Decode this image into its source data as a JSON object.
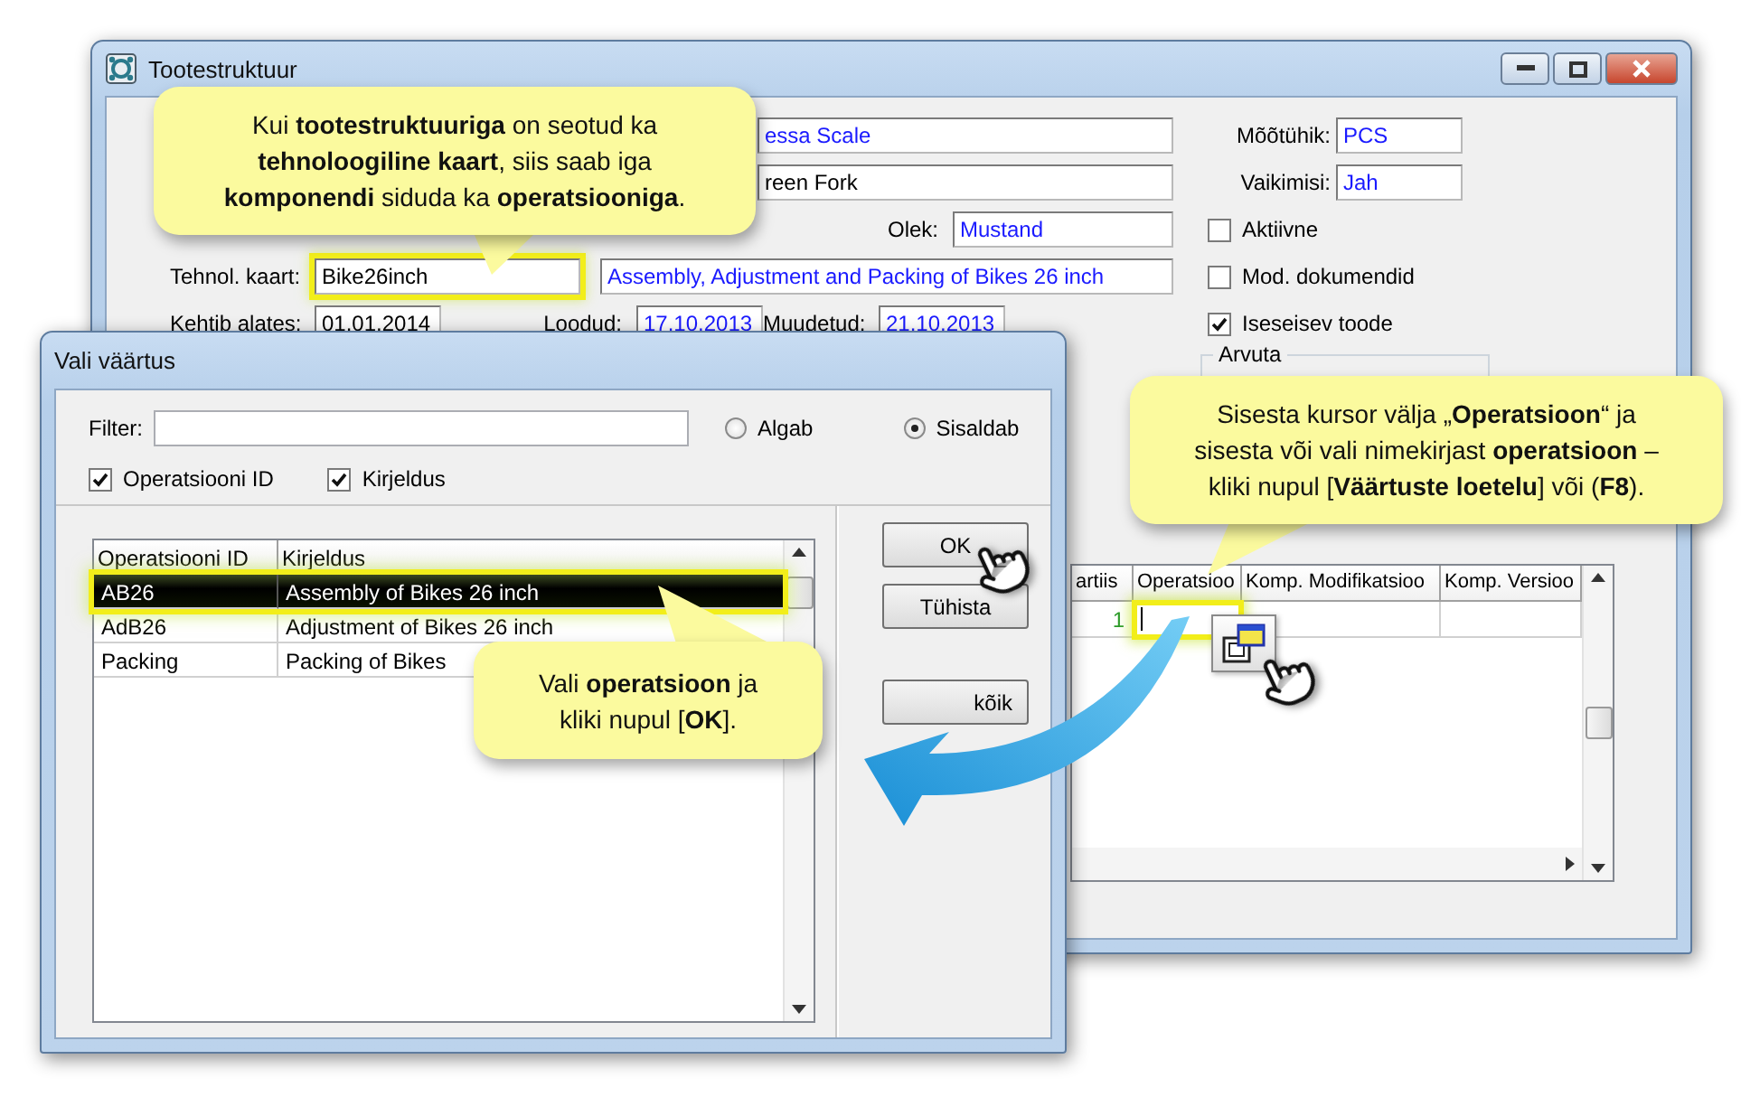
{
  "main_window": {
    "title": "Tootestruktuur",
    "name_field": "essa Scale",
    "modification_field": "reen Fork",
    "unit": {
      "label": "Mõõtühik:",
      "value": "PCS"
    },
    "default_flag": {
      "label": "Vaikimisi:",
      "value": "Jah"
    },
    "status": {
      "label": "Olek:",
      "value": "Mustand"
    },
    "routing": {
      "label": "Tehnol. kaart:",
      "value": "Bike26inch",
      "highlighted": true,
      "description": "Assembly, Adjustment and Packing of Bikes 26 inch"
    },
    "dates": [
      {
        "label": "Kehtib alates:",
        "value": "01.01.2014"
      },
      {
        "label": "Loodud:",
        "value": "17.10.2013"
      },
      {
        "label": "Muudetud:",
        "value": "21.10.2013"
      }
    ],
    "checkboxes": [
      {
        "label": "Aktiivne",
        "checked": false
      },
      {
        "label": "Mod. dokumendid",
        "checked": false
      },
      {
        "label": "Iseseisev toode",
        "checked": true
      }
    ],
    "group": {
      "label": "Arvuta"
    },
    "components_table": {
      "columns": [
        "artiis",
        "Operatsioo",
        "Komp. Modifikatsioo",
        "Komp. Versioo"
      ],
      "rows": [
        {
          "quantity": "1",
          "operation_focused": true
        }
      ]
    }
  },
  "dialog": {
    "title": "Vali väärtus",
    "filter": {
      "label": "Filter:"
    },
    "match_options": [
      {
        "label": "Algab",
        "selected": false
      },
      {
        "label": "Sisaldab",
        "selected": true
      }
    ],
    "search_columns": [
      {
        "label": "Operatsiooni ID",
        "checked": true
      },
      {
        "label": "Kirjeldus",
        "checked": true
      }
    ],
    "list": {
      "columns": [
        "Operatsiooni ID",
        "Kirjeldus"
      ],
      "rows": [
        {
          "id": "AB26",
          "description": "Assembly of Bikes 26 inch",
          "selected": true
        },
        {
          "id": "AdB26",
          "description": "Adjustment of Bikes 26 inch",
          "selected": false
        },
        {
          "id": "Packing",
          "description": "Packing of Bikes",
          "selected": false
        }
      ]
    },
    "buttons": [
      "OK",
      "Tühista",
      "kõik"
    ]
  },
  "callouts": [
    {
      "text": "Kui **tootestruktuuriga** on seotud ka\n**tehnoloogiline kaart**, siis saab iga\n**komponendi** siduda ka **operatsiooniga**."
    },
    {
      "text": "Sisesta kursor välja „**Operatsioon**“ ja\nsisesta või vali nimekirjast **operatsioon** –\nkliki nupul [**Väärtuste loetelu**] või (**F8**)."
    },
    {
      "text": "Vali **operatsioon** ja\nkliki nupul [**OK**]."
    }
  ]
}
